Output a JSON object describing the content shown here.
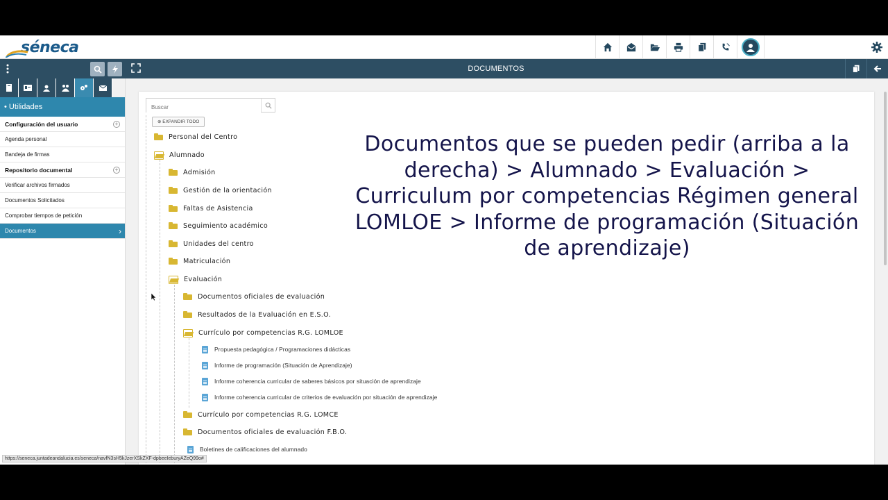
{
  "app": {
    "logo": "séneca",
    "title": "DOCUMENTOS"
  },
  "topbar": {
    "icons": [
      "home-icon",
      "envelope-icon",
      "folder-open-icon",
      "print-icon",
      "copy-icon",
      "phone-icon",
      "user-avatar-icon",
      "gear-icon"
    ]
  },
  "sidebar": {
    "section": "• Utilidades",
    "items": [
      {
        "label": "Configuración del usuario",
        "group": true
      },
      {
        "label": "Agenda personal"
      },
      {
        "label": "Bandeja de firmas"
      },
      {
        "label": "Repositorio documental",
        "group": true
      },
      {
        "label": "Verificar archivos firmados"
      },
      {
        "label": "Documentos Solicitados"
      },
      {
        "label": "Comprobar tiempos de petición"
      },
      {
        "label": "Documentos",
        "selected": true
      }
    ]
  },
  "main": {
    "search_placeholder": "Buscar",
    "expand_all": "EXPANDIR TODO",
    "tree": [
      {
        "label": "Personal del Centro",
        "type": "folder"
      },
      {
        "label": "Alumnado",
        "type": "folder-open"
      },
      {
        "label": "Admisión",
        "type": "folder"
      },
      {
        "label": "Gestión de la orientación",
        "type": "folder"
      },
      {
        "label": "Faltas de Asistencia",
        "type": "folder"
      },
      {
        "label": "Seguimiento académico",
        "type": "folder"
      },
      {
        "label": "Unidades del centro",
        "type": "folder"
      },
      {
        "label": "Matriculación",
        "type": "folder"
      },
      {
        "label": "Evaluación",
        "type": "folder-open"
      },
      {
        "label": "Documentos oficiales de evaluación",
        "type": "folder"
      },
      {
        "label": "Resultados de la Evaluación en E.S.O.",
        "type": "folder"
      },
      {
        "label": "Currículo por competencias R.G. LOMLOE",
        "type": "folder-open"
      },
      {
        "label": "Propuesta pedagógica / Programaciones didácticas",
        "type": "doc"
      },
      {
        "label": "Informe de programación (Situación de Aprendizaje)",
        "type": "doc"
      },
      {
        "label": "Informe coherencia curricular de saberes básicos por situación de aprendizaje",
        "type": "doc"
      },
      {
        "label": "Informe coherencia curricular de criterios de evaluación por situación de aprendizaje",
        "type": "doc"
      },
      {
        "label": "Currículo por competencias R.G. LOMCE",
        "type": "folder"
      },
      {
        "label": "Documentos oficiales de evaluación F.B.O.",
        "type": "folder"
      },
      {
        "label": "Boletines de calificaciones del alumnado",
        "type": "doc"
      }
    ],
    "overlay_text": "Documentos que se pueden pedir (arriba a la derecha) > Alumnado > Evaluación > Curriculum por competencias Régimen general LOMLOE > Informe de programación (Situación de aprendizaje)"
  },
  "status_url": "https://seneca.juntadeandalucia.es/seneca/navfN3sH5kJzerXSkZXF-dpbeeIeburyAZeQ99o#"
}
